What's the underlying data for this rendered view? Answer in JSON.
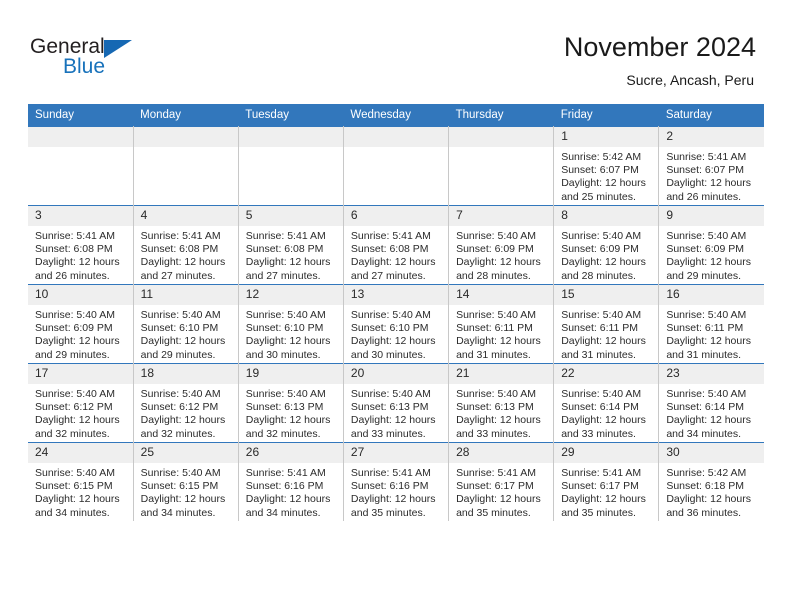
{
  "brand": {
    "name_part1": "General",
    "name_part2": "Blue",
    "color_dark": "#231f20",
    "color_blue": "#1872bb",
    "triangle_color": "#1668b3"
  },
  "header": {
    "title": "November 2024",
    "subtitle": "Sucre, Ancash, Peru"
  },
  "theme": {
    "header_row_bg": "#3277bc",
    "header_row_text": "#ffffff",
    "daynum_bg": "#efefef",
    "cell_border": "#c8c8c8",
    "row_border": "#3277bc"
  },
  "weekday_headers": [
    "Sunday",
    "Monday",
    "Tuesday",
    "Wednesday",
    "Thursday",
    "Friday",
    "Saturday"
  ],
  "weeks": [
    [
      {
        "day": "",
        "empty": true,
        "sunrise": "",
        "sunset": "",
        "daylight_line1": "",
        "daylight_line2": ""
      },
      {
        "day": "",
        "empty": true,
        "sunrise": "",
        "sunset": "",
        "daylight_line1": "",
        "daylight_line2": ""
      },
      {
        "day": "",
        "empty": true,
        "sunrise": "",
        "sunset": "",
        "daylight_line1": "",
        "daylight_line2": ""
      },
      {
        "day": "",
        "empty": true,
        "sunrise": "",
        "sunset": "",
        "daylight_line1": "",
        "daylight_line2": ""
      },
      {
        "day": "",
        "empty": true,
        "sunrise": "",
        "sunset": "",
        "daylight_line1": "",
        "daylight_line2": ""
      },
      {
        "day": "1",
        "empty": false,
        "sunrise": "Sunrise: 5:42 AM",
        "sunset": "Sunset: 6:07 PM",
        "daylight_line1": "Daylight: 12 hours",
        "daylight_line2": "and 25 minutes."
      },
      {
        "day": "2",
        "empty": false,
        "sunrise": "Sunrise: 5:41 AM",
        "sunset": "Sunset: 6:07 PM",
        "daylight_line1": "Daylight: 12 hours",
        "daylight_line2": "and 26 minutes."
      }
    ],
    [
      {
        "day": "3",
        "empty": false,
        "sunrise": "Sunrise: 5:41 AM",
        "sunset": "Sunset: 6:08 PM",
        "daylight_line1": "Daylight: 12 hours",
        "daylight_line2": "and 26 minutes."
      },
      {
        "day": "4",
        "empty": false,
        "sunrise": "Sunrise: 5:41 AM",
        "sunset": "Sunset: 6:08 PM",
        "daylight_line1": "Daylight: 12 hours",
        "daylight_line2": "and 27 minutes."
      },
      {
        "day": "5",
        "empty": false,
        "sunrise": "Sunrise: 5:41 AM",
        "sunset": "Sunset: 6:08 PM",
        "daylight_line1": "Daylight: 12 hours",
        "daylight_line2": "and 27 minutes."
      },
      {
        "day": "6",
        "empty": false,
        "sunrise": "Sunrise: 5:41 AM",
        "sunset": "Sunset: 6:08 PM",
        "daylight_line1": "Daylight: 12 hours",
        "daylight_line2": "and 27 minutes."
      },
      {
        "day": "7",
        "empty": false,
        "sunrise": "Sunrise: 5:40 AM",
        "sunset": "Sunset: 6:09 PM",
        "daylight_line1": "Daylight: 12 hours",
        "daylight_line2": "and 28 minutes."
      },
      {
        "day": "8",
        "empty": false,
        "sunrise": "Sunrise: 5:40 AM",
        "sunset": "Sunset: 6:09 PM",
        "daylight_line1": "Daylight: 12 hours",
        "daylight_line2": "and 28 minutes."
      },
      {
        "day": "9",
        "empty": false,
        "sunrise": "Sunrise: 5:40 AM",
        "sunset": "Sunset: 6:09 PM",
        "daylight_line1": "Daylight: 12 hours",
        "daylight_line2": "and 29 minutes."
      }
    ],
    [
      {
        "day": "10",
        "empty": false,
        "sunrise": "Sunrise: 5:40 AM",
        "sunset": "Sunset: 6:09 PM",
        "daylight_line1": "Daylight: 12 hours",
        "daylight_line2": "and 29 minutes."
      },
      {
        "day": "11",
        "empty": false,
        "sunrise": "Sunrise: 5:40 AM",
        "sunset": "Sunset: 6:10 PM",
        "daylight_line1": "Daylight: 12 hours",
        "daylight_line2": "and 29 minutes."
      },
      {
        "day": "12",
        "empty": false,
        "sunrise": "Sunrise: 5:40 AM",
        "sunset": "Sunset: 6:10 PM",
        "daylight_line1": "Daylight: 12 hours",
        "daylight_line2": "and 30 minutes."
      },
      {
        "day": "13",
        "empty": false,
        "sunrise": "Sunrise: 5:40 AM",
        "sunset": "Sunset: 6:10 PM",
        "daylight_line1": "Daylight: 12 hours",
        "daylight_line2": "and 30 minutes."
      },
      {
        "day": "14",
        "empty": false,
        "sunrise": "Sunrise: 5:40 AM",
        "sunset": "Sunset: 6:11 PM",
        "daylight_line1": "Daylight: 12 hours",
        "daylight_line2": "and 31 minutes."
      },
      {
        "day": "15",
        "empty": false,
        "sunrise": "Sunrise: 5:40 AM",
        "sunset": "Sunset: 6:11 PM",
        "daylight_line1": "Daylight: 12 hours",
        "daylight_line2": "and 31 minutes."
      },
      {
        "day": "16",
        "empty": false,
        "sunrise": "Sunrise: 5:40 AM",
        "sunset": "Sunset: 6:11 PM",
        "daylight_line1": "Daylight: 12 hours",
        "daylight_line2": "and 31 minutes."
      }
    ],
    [
      {
        "day": "17",
        "empty": false,
        "sunrise": "Sunrise: 5:40 AM",
        "sunset": "Sunset: 6:12 PM",
        "daylight_line1": "Daylight: 12 hours",
        "daylight_line2": "and 32 minutes."
      },
      {
        "day": "18",
        "empty": false,
        "sunrise": "Sunrise: 5:40 AM",
        "sunset": "Sunset: 6:12 PM",
        "daylight_line1": "Daylight: 12 hours",
        "daylight_line2": "and 32 minutes."
      },
      {
        "day": "19",
        "empty": false,
        "sunrise": "Sunrise: 5:40 AM",
        "sunset": "Sunset: 6:13 PM",
        "daylight_line1": "Daylight: 12 hours",
        "daylight_line2": "and 32 minutes."
      },
      {
        "day": "20",
        "empty": false,
        "sunrise": "Sunrise: 5:40 AM",
        "sunset": "Sunset: 6:13 PM",
        "daylight_line1": "Daylight: 12 hours",
        "daylight_line2": "and 33 minutes."
      },
      {
        "day": "21",
        "empty": false,
        "sunrise": "Sunrise: 5:40 AM",
        "sunset": "Sunset: 6:13 PM",
        "daylight_line1": "Daylight: 12 hours",
        "daylight_line2": "and 33 minutes."
      },
      {
        "day": "22",
        "empty": false,
        "sunrise": "Sunrise: 5:40 AM",
        "sunset": "Sunset: 6:14 PM",
        "daylight_line1": "Daylight: 12 hours",
        "daylight_line2": "and 33 minutes."
      },
      {
        "day": "23",
        "empty": false,
        "sunrise": "Sunrise: 5:40 AM",
        "sunset": "Sunset: 6:14 PM",
        "daylight_line1": "Daylight: 12 hours",
        "daylight_line2": "and 34 minutes."
      }
    ],
    [
      {
        "day": "24",
        "empty": false,
        "sunrise": "Sunrise: 5:40 AM",
        "sunset": "Sunset: 6:15 PM",
        "daylight_line1": "Daylight: 12 hours",
        "daylight_line2": "and 34 minutes."
      },
      {
        "day": "25",
        "empty": false,
        "sunrise": "Sunrise: 5:40 AM",
        "sunset": "Sunset: 6:15 PM",
        "daylight_line1": "Daylight: 12 hours",
        "daylight_line2": "and 34 minutes."
      },
      {
        "day": "26",
        "empty": false,
        "sunrise": "Sunrise: 5:41 AM",
        "sunset": "Sunset: 6:16 PM",
        "daylight_line1": "Daylight: 12 hours",
        "daylight_line2": "and 34 minutes."
      },
      {
        "day": "27",
        "empty": false,
        "sunrise": "Sunrise: 5:41 AM",
        "sunset": "Sunset: 6:16 PM",
        "daylight_line1": "Daylight: 12 hours",
        "daylight_line2": "and 35 minutes."
      },
      {
        "day": "28",
        "empty": false,
        "sunrise": "Sunrise: 5:41 AM",
        "sunset": "Sunset: 6:17 PM",
        "daylight_line1": "Daylight: 12 hours",
        "daylight_line2": "and 35 minutes."
      },
      {
        "day": "29",
        "empty": false,
        "sunrise": "Sunrise: 5:41 AM",
        "sunset": "Sunset: 6:17 PM",
        "daylight_line1": "Daylight: 12 hours",
        "daylight_line2": "and 35 minutes."
      },
      {
        "day": "30",
        "empty": false,
        "sunrise": "Sunrise: 5:42 AM",
        "sunset": "Sunset: 6:18 PM",
        "daylight_line1": "Daylight: 12 hours",
        "daylight_line2": "and 36 minutes."
      }
    ]
  ]
}
